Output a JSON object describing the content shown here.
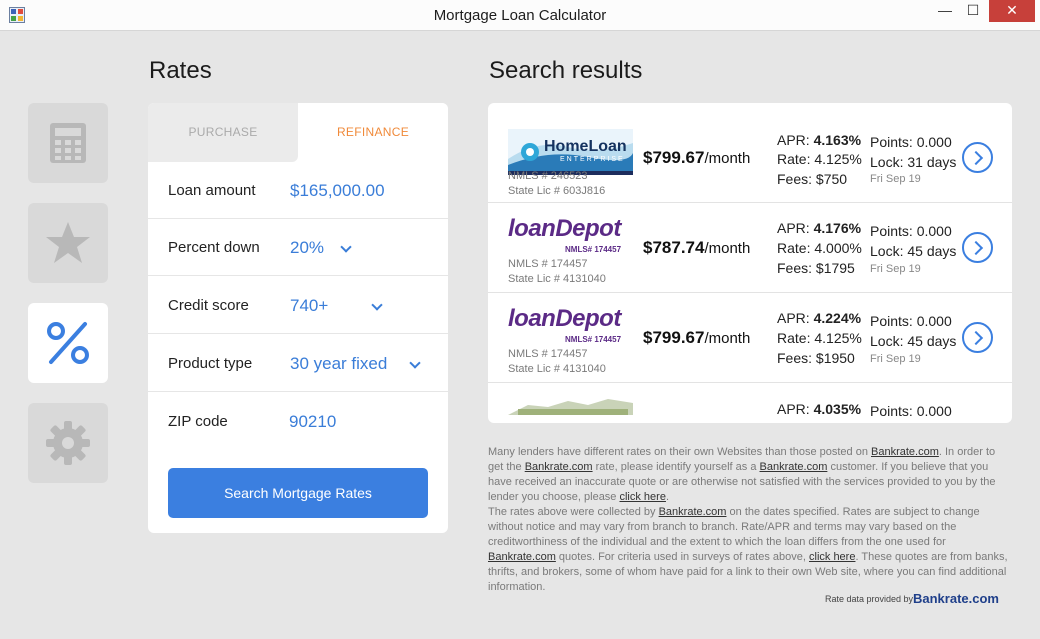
{
  "window": {
    "title": "Mortgage Loan Calculator",
    "min": "—",
    "max": "☐",
    "close": "✕"
  },
  "nav": {
    "items": [
      "calculator-icon",
      "star-icon",
      "percent-icon",
      "gear-icon"
    ],
    "active": "percent-icon"
  },
  "rates": {
    "heading": "Rates",
    "tabs": {
      "purchase": "PURCHASE",
      "refinance": "REFINANCE",
      "active": "REFINANCE"
    },
    "fields": [
      {
        "label": "Loan amount",
        "value": "$165,000.00"
      },
      {
        "label": "Percent down",
        "value": "20%"
      },
      {
        "label": "Credit score",
        "value": "740+"
      },
      {
        "label": "Product type",
        "value": "30 year fixed"
      },
      {
        "label": "ZIP code",
        "value": "90210"
      }
    ],
    "search_button": "Search Mortgage Rates"
  },
  "results": {
    "heading": "Search results",
    "items": [
      {
        "logo_text": "HomeLoan",
        "logo_sub": "ENTERPRISE",
        "nmls": "NMLS # 246523",
        "lic": "State Lic # 603J816",
        "monthly": "$799.67",
        "monthly_unit": "/month",
        "apr_label": "APR:",
        "apr": "4.163%",
        "rate_label": "Rate:",
        "rate": "4.125%",
        "fees_label": "Fees:",
        "fees": "$750",
        "points_label": "Points:",
        "points": "0.000",
        "lock_label": "Lock:",
        "lock": "31 days",
        "date": "Fri Sep 19"
      },
      {
        "logo_text": "loanDepot",
        "logo_sub": "NMLS# 174457",
        "nmls": "NMLS # 174457",
        "lic": "State Lic # 4131040",
        "monthly": "$787.74",
        "monthly_unit": "/month",
        "apr_label": "APR:",
        "apr": "4.176%",
        "rate_label": "Rate:",
        "rate": "4.000%",
        "fees_label": "Fees:",
        "fees": "$1795",
        "points_label": "Points:",
        "points": "0.000",
        "lock_label": "Lock:",
        "lock": "45 days",
        "date": "Fri Sep 19"
      },
      {
        "logo_text": "loanDepot",
        "logo_sub": "NMLS# 174457",
        "nmls": "NMLS # 174457",
        "lic": "State Lic # 4131040",
        "monthly": "$799.67",
        "monthly_unit": "/month",
        "apr_label": "APR:",
        "apr": "4.224%",
        "rate_label": "Rate:",
        "rate": "4.125%",
        "fees_label": "Fees:",
        "fees": "$1950",
        "points_label": "Points:",
        "points": "0.000",
        "lock_label": "Lock:",
        "lock": "45 days",
        "date": "Fri Sep 19"
      },
      {
        "apr_label": "APR:",
        "apr": "4.035%",
        "points_label": "Points:",
        "points": "0.000"
      }
    ]
  },
  "disclaimer": {
    "p1a": "Many lenders have different rates on their own Websites than those posted on ",
    "link_bankrate": "Bankrate.com",
    "p1b": ". In order to get the ",
    "p1c": " rate, please identify yourself as a ",
    "p1d": " customer. If you believe that you have received an inaccurate quote or are otherwise not satisfied with the services provided to you by the lender you choose, please ",
    "link_click": "click here",
    "p1e": ".",
    "p2a": "The rates above were collected by ",
    "p2b": " on the dates specified. Rates are subject to change without notice and may vary from branch to branch. Rate/APR and terms may vary based on the creditworthiness of the individual and the extent to which the loan differs from the one used for ",
    "p2c": " quotes. For criteria used in surveys of rates above, ",
    "p2d": ". These quotes are from banks, thrifts, and brokers, some of whom have paid for a link to their own Web site, where you can find additional information.",
    "provided_by": "Rate data provided by",
    "provider_logo": "Bankrate.com"
  },
  "colors": {
    "accent": "#3b7fe0",
    "orange": "#f08a3a",
    "loandepot": "#5b2a86"
  }
}
